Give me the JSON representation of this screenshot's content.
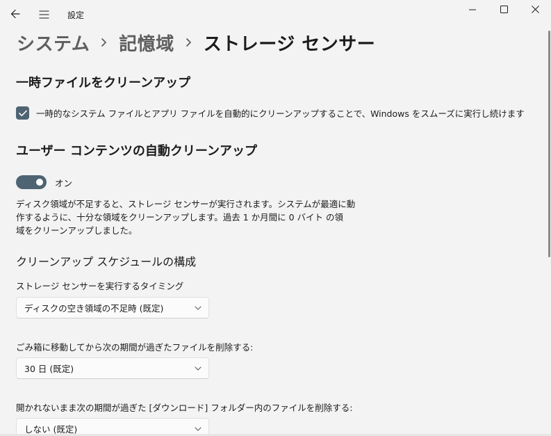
{
  "titlebar": {
    "app_title": "設定"
  },
  "breadcrumb": {
    "items": [
      "システム",
      "記憶域"
    ],
    "current": "ストレージ センサー"
  },
  "temp_files": {
    "title": "一時ファイルをクリーンアップ",
    "checkbox_label": "一時的なシステム ファイルとアプリ ファイルを自動的にクリーンアップすることで、Windows をスムーズに実行し続けます",
    "checked": true
  },
  "user_content": {
    "title": "ユーザー コンテンツの自動クリーンアップ",
    "toggle_label": "オン",
    "toggle_on": true,
    "description_lines": [
      "ディスク領域が不足すると、ストレージ センサーが実行されます。システムが最適に動",
      "作するように、十分な領域をクリーンアップします。過去 1 か月間に 0 バイト の領",
      "域をクリーンアップしました。"
    ]
  },
  "schedule": {
    "heading": "クリーンアップ スケジュールの構成",
    "timing_label": "ストレージ センサーを実行するタイミング",
    "timing_value": "ディスクの空き領域の不足時 (既定)",
    "recycle_label": "ごみ箱に移動してから次の期間が過ぎたファイルを削除する:",
    "recycle_value": "30 日 (既定)",
    "downloads_label": "開かれないまま次の期間が過ぎた [ダウンロード] フォルダー内のファイルを削除する:",
    "downloads_value": "しない (既定)"
  },
  "colors": {
    "accent": "#4f6472",
    "background": "#f3f3f3",
    "dropdown_bg": "#fbfbfb"
  },
  "icons": [
    "back-arrow-icon",
    "hamburger-menu-icon",
    "minimize-icon",
    "maximize-icon",
    "close-icon",
    "breadcrumb-chevron-icon",
    "checkmark-icon",
    "chevron-down-icon"
  ]
}
